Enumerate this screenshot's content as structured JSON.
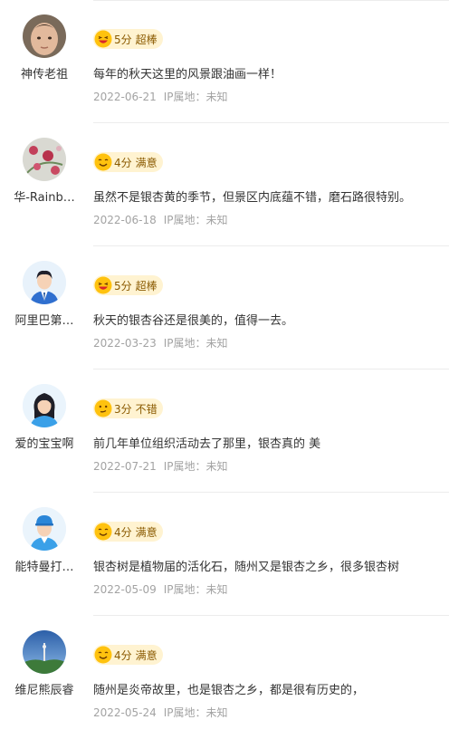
{
  "reviews": [
    {
      "username": "神传老祖",
      "avatar": "child-photo-avatar",
      "score": "5分",
      "level": "超棒",
      "mood": "laughing-emoji-icon",
      "text": "每年的秋天这里的风景跟油画一样！",
      "date": "2022-06-21",
      "ip": "IP属地：未知"
    },
    {
      "username": "华-Rainb…",
      "avatar": "flowers-photo-avatar",
      "score": "4分",
      "level": "满意",
      "mood": "smiling-emoji-icon",
      "text": "虽然不是银杏黄的季节，但景区内底蕴不错，磨石路很特别。",
      "date": "2022-06-18",
      "ip": "IP属地：未知"
    },
    {
      "username": "阿里巴第…",
      "avatar": "man-suit-avatar",
      "score": "5分",
      "level": "超棒",
      "mood": "laughing-emoji-icon",
      "text": "秋天的银杏谷还是很美的，值得一去。",
      "date": "2022-03-23",
      "ip": "IP属地：未知"
    },
    {
      "username": "爱的宝宝啊",
      "avatar": "woman-avatar",
      "score": "3分",
      "level": "不错",
      "mood": "neutral-emoji-icon",
      "text": "前几年单位组织活动去了那里，银杏真的 美",
      "date": "2022-07-21",
      "ip": "IP属地：未知"
    },
    {
      "username": "能特曼打…",
      "avatar": "man-cap-avatar",
      "score": "4分",
      "level": "满意",
      "mood": "smiling-emoji-icon",
      "text": "银杏树是植物届的活化石，随州又是银杏之乡，很多银杏树",
      "date": "2022-05-09",
      "ip": "IP属地：未知"
    },
    {
      "username": "维尼熊辰睿",
      "avatar": "sky-tower-photo-avatar",
      "score": "4分",
      "level": "满意",
      "mood": "smiling-emoji-icon",
      "text": "随州是炎帝故里，也是银杏之乡，都是很有历史的，",
      "date": "2022-05-24",
      "ip": "IP属地：未知"
    }
  ]
}
